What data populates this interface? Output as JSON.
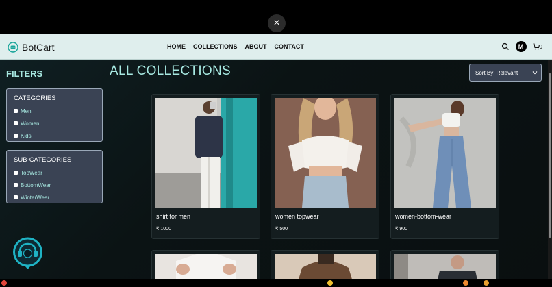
{
  "overlay": {
    "close_icon": "×"
  },
  "brand": {
    "name": "BotCart",
    "logo_icon": "robot-icon"
  },
  "nav": {
    "links": [
      "HOME",
      "COLLECTIONS",
      "ABOUT",
      "CONTACT"
    ],
    "avatar_initial": "M",
    "cart_count": "0"
  },
  "filters": {
    "title": "FILTERS",
    "categories": {
      "heading": "CATEGORIES",
      "options": [
        "Men",
        "Women",
        "Kids"
      ]
    },
    "subcategories": {
      "heading": "SUB-CATEGORIES",
      "options": [
        "TopWear",
        "BottomWear",
        "WinterWear"
      ]
    }
  },
  "collection": {
    "title": "ALL COLLECTIONS",
    "sort_label": "Sort By: Relevant"
  },
  "products": [
    {
      "name": "shirt for men",
      "price": "₹ 1000"
    },
    {
      "name": "women topwear",
      "price": "₹ 500"
    },
    {
      "name": "women-bottom-wear",
      "price": "₹ 900"
    }
  ],
  "colors": {
    "accent": "#a7e8e1",
    "panel": "#3a4354",
    "navbar": "#dfeeed"
  }
}
